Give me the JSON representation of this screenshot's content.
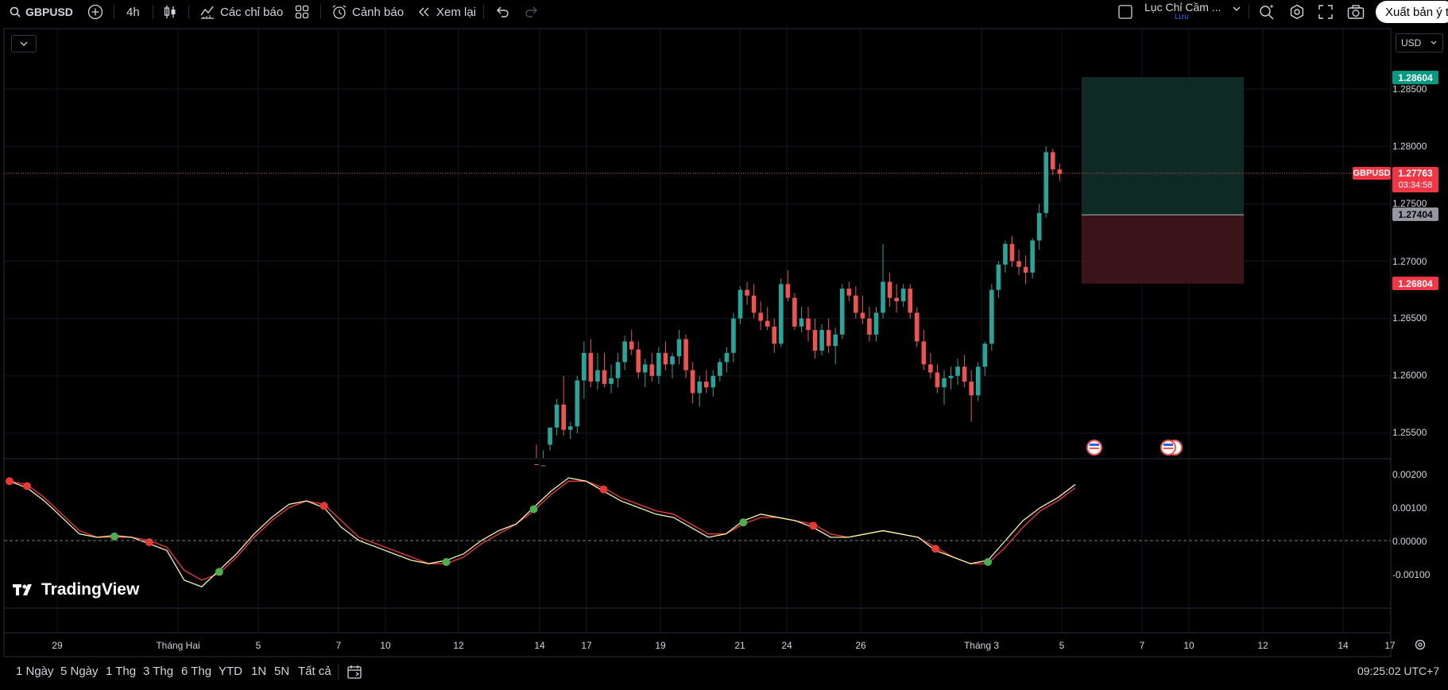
{
  "toolbar": {
    "symbol": "GBPUSD",
    "interval": "4h",
    "indicators_label": "Các chỉ báo",
    "alert_label": "Cảnh báo",
    "replay_label": "Xem lại",
    "layout_name": "Lục Chỉ Cầm ...",
    "save_label": "Lưu",
    "publish_label": "Xuất bản ý tưởng"
  },
  "chart": {
    "currency": "USD",
    "symbol_tag": "GBPUSD",
    "current_price": "1.27763",
    "countdown": "03:34:58",
    "target_price": "1.28604",
    "entry_price": "1.27404",
    "stop_price": "1.26804",
    "price_axis": [
      "1.28500",
      "1.28000",
      "1.27500",
      "1.27000",
      "1.26500",
      "1.26000",
      "1.25500"
    ],
    "osc_axis": [
      "0.00200",
      "0.00100",
      "0.00000",
      "-0.00100"
    ],
    "time_axis": [
      "29",
      "Tháng Hai",
      "5",
      "7",
      "10",
      "12",
      "14",
      "17",
      "19",
      "21",
      "24",
      "26",
      "Tháng 3",
      "5",
      "7",
      "10",
      "12",
      "14",
      "17"
    ],
    "watermark": "TradingView",
    "colors": {
      "up": "#26a69a",
      "down": "#ef5350",
      "target_zone": "#0d2a24",
      "stop_zone": "#3a1418"
    }
  },
  "bottombar": {
    "ranges": [
      "1 Ngày",
      "5 Ngày",
      "1 Thg",
      "3 Thg",
      "6 Thg",
      "YTD",
      "1N",
      "5N",
      "Tất cả"
    ],
    "clock": "09:25:02 UTC+7"
  },
  "chart_data": {
    "type": "candlestick",
    "symbol": "GBPUSD",
    "interval": "4h",
    "ylim": [
      1.2522,
      1.289
    ],
    "candles": [
      [
        1.2523,
        1.254,
        1.2518,
        1.2522
      ],
      [
        1.252,
        1.2535,
        1.2512,
        1.2522
      ],
      [
        1.254,
        1.2555,
        1.2535,
        1.2555
      ],
      [
        1.2555,
        1.258,
        1.2548,
        1.2575
      ],
      [
        1.2575,
        1.26,
        1.2548,
        1.2553
      ],
      [
        1.2553,
        1.256,
        1.2545,
        1.2556
      ],
      [
        1.2556,
        1.26,
        1.255,
        1.2596
      ],
      [
        1.2596,
        1.263,
        1.258,
        1.262
      ],
      [
        1.262,
        1.2632,
        1.259,
        1.2595
      ],
      [
        1.2595,
        1.262,
        1.2588,
        1.2605
      ],
      [
        1.2605,
        1.262,
        1.259,
        1.2593
      ],
      [
        1.2593,
        1.261,
        1.2585,
        1.2598
      ],
      [
        1.2598,
        1.262,
        1.259,
        1.2612
      ],
      [
        1.2612,
        1.2635,
        1.2605,
        1.263
      ],
      [
        1.263,
        1.264,
        1.2618,
        1.2623
      ],
      [
        1.2623,
        1.263,
        1.2598,
        1.2603
      ],
      [
        1.2603,
        1.2615,
        1.259,
        1.261
      ],
      [
        1.261,
        1.262,
        1.2595,
        1.26
      ],
      [
        1.26,
        1.2625,
        1.2593,
        1.262
      ],
      [
        1.262,
        1.263,
        1.2605,
        1.261
      ],
      [
        1.261,
        1.262,
        1.2598,
        1.2617
      ],
      [
        1.2617,
        1.264,
        1.261,
        1.2632
      ],
      [
        1.2632,
        1.2636,
        1.2598,
        1.2605
      ],
      [
        1.2605,
        1.2612,
        1.2576,
        1.2585
      ],
      [
        1.2585,
        1.26,
        1.2573,
        1.2595
      ],
      [
        1.2595,
        1.2605,
        1.2585,
        1.259
      ],
      [
        1.259,
        1.2605,
        1.2582,
        1.26
      ],
      [
        1.26,
        1.2615,
        1.2595,
        1.2612
      ],
      [
        1.2612,
        1.2625,
        1.2603,
        1.262
      ],
      [
        1.262,
        1.2655,
        1.2612,
        1.265
      ],
      [
        1.265,
        1.2678,
        1.2645,
        1.2675
      ],
      [
        1.2675,
        1.2682,
        1.2662,
        1.267
      ],
      [
        1.267,
        1.268,
        1.265,
        1.2655
      ],
      [
        1.2655,
        1.2665,
        1.264,
        1.2648
      ],
      [
        1.2648,
        1.266,
        1.264,
        1.2643
      ],
      [
        1.2643,
        1.265,
        1.262,
        1.2628
      ],
      [
        1.2628,
        1.2685,
        1.2625,
        1.268
      ],
      [
        1.268,
        1.2692,
        1.2665,
        1.2668
      ],
      [
        1.2668,
        1.2672,
        1.264,
        1.2643
      ],
      [
        1.2643,
        1.266,
        1.2638,
        1.265
      ],
      [
        1.265,
        1.266,
        1.263,
        1.264
      ],
      [
        1.264,
        1.265,
        1.2615,
        1.2622
      ],
      [
        1.2622,
        1.2645,
        1.2618,
        1.264
      ],
      [
        1.264,
        1.265,
        1.262,
        1.2626
      ],
      [
        1.2626,
        1.2642,
        1.261,
        1.2636
      ],
      [
        1.2636,
        1.268,
        1.2632,
        1.2676
      ],
      [
        1.2676,
        1.2682,
        1.2665,
        1.267
      ],
      [
        1.267,
        1.2678,
        1.265,
        1.2655
      ],
      [
        1.2655,
        1.267,
        1.2645,
        1.265
      ],
      [
        1.265,
        1.266,
        1.263,
        1.2636
      ],
      [
        1.2636,
        1.266,
        1.263,
        1.2655
      ],
      [
        1.2655,
        1.2715,
        1.265,
        1.2682
      ],
      [
        1.2682,
        1.269,
        1.266,
        1.2668
      ],
      [
        1.2668,
        1.268,
        1.2655,
        1.2665
      ],
      [
        1.2665,
        1.268,
        1.266,
        1.2676
      ],
      [
        1.2676,
        1.268,
        1.265,
        1.2655
      ],
      [
        1.2655,
        1.266,
        1.2625,
        1.263
      ],
      [
        1.263,
        1.264,
        1.2605,
        1.261
      ],
      [
        1.261,
        1.262,
        1.2598,
        1.2603
      ],
      [
        1.2603,
        1.261,
        1.2585,
        1.259
      ],
      [
        1.259,
        1.2605,
        1.2575,
        1.2598
      ],
      [
        1.2598,
        1.2608,
        1.2588,
        1.26
      ],
      [
        1.26,
        1.2615,
        1.2592,
        1.2608
      ],
      [
        1.2608,
        1.2618,
        1.259,
        1.2595
      ],
      [
        1.2595,
        1.2605,
        1.256,
        1.2583
      ],
      [
        1.2583,
        1.2612,
        1.2578,
        1.2608
      ],
      [
        1.2608,
        1.263,
        1.26,
        1.2628
      ],
      [
        1.2628,
        1.268,
        1.2622,
        1.2675
      ],
      [
        1.2675,
        1.27,
        1.2668,
        1.2697
      ],
      [
        1.2697,
        1.2718,
        1.269,
        1.2715
      ],
      [
        1.2715,
        1.2722,
        1.2695,
        1.27
      ],
      [
        1.27,
        1.271,
        1.2688,
        1.2695
      ],
      [
        1.2695,
        1.2705,
        1.268,
        1.269
      ],
      [
        1.269,
        1.272,
        1.2685,
        1.2718
      ],
      [
        1.2718,
        1.275,
        1.271,
        1.2742
      ],
      [
        1.2742,
        1.28,
        1.2738,
        1.2795
      ],
      [
        1.2795,
        1.2798,
        1.2775,
        1.278
      ],
      [
        1.278,
        1.2785,
        1.277,
        1.2776
      ]
    ],
    "position": {
      "target": 1.28604,
      "entry": 1.27404,
      "stop": 1.26804
    },
    "oscillator": {
      "ylim": [
        -0.0015,
        0.0023
      ],
      "fast": [
        0.0018,
        0.0016,
        0.0012,
        0.0007,
        0.0002,
        0.0001,
        0.00015,
        0.0001,
        -0.0001,
        -0.0003,
        -0.0012,
        -0.0014,
        -0.0009,
        -0.0004,
        0.0002,
        0.0007,
        0.0011,
        0.0012,
        0.001,
        0.0004,
        0.0,
        -0.0002,
        -0.0004,
        -0.0006,
        -0.0007,
        -0.0006,
        -0.0004,
        0.0,
        0.0003,
        0.0005,
        0.001,
        0.0015,
        0.0019,
        0.0018,
        0.0015,
        0.0012,
        0.001,
        0.0008,
        0.0007,
        0.0004,
        0.0001,
        0.0002,
        0.0006,
        0.0008,
        0.0007,
        0.0006,
        0.0004,
        0.0001,
        0.0001,
        0.0002,
        0.0003,
        0.0002,
        0.0001,
        -0.0003,
        -0.0005,
        -0.0007,
        -0.0006,
        0.0,
        0.0006,
        0.001,
        0.0013,
        0.0017
      ],
      "slow": [
        0.0018,
        0.0017,
        0.0013,
        0.0008,
        0.0003,
        0.0001,
        0.0001,
        0.0001,
        0.0,
        -0.0002,
        -0.0009,
        -0.0012,
        -0.001,
        -0.0005,
        0.0001,
        0.0006,
        0.001,
        0.0012,
        0.0011,
        0.0006,
        0.0001,
        -0.0001,
        -0.0003,
        -0.0005,
        -0.0007,
        -0.0007,
        -0.0005,
        -0.0001,
        0.0002,
        0.0005,
        0.0009,
        0.0014,
        0.0018,
        0.0018,
        0.0016,
        0.0013,
        0.0011,
        0.0009,
        0.0008,
        0.0005,
        0.0002,
        0.0002,
        0.0005,
        0.0007,
        0.0007,
        0.0006,
        0.0005,
        0.0002,
        0.0001,
        0.0002,
        0.0003,
        0.0002,
        0.0001,
        -0.0002,
        -0.0005,
        -0.0007,
        -0.0007,
        -0.0002,
        0.0004,
        0.0009,
        0.0012,
        0.0016
      ]
    }
  }
}
